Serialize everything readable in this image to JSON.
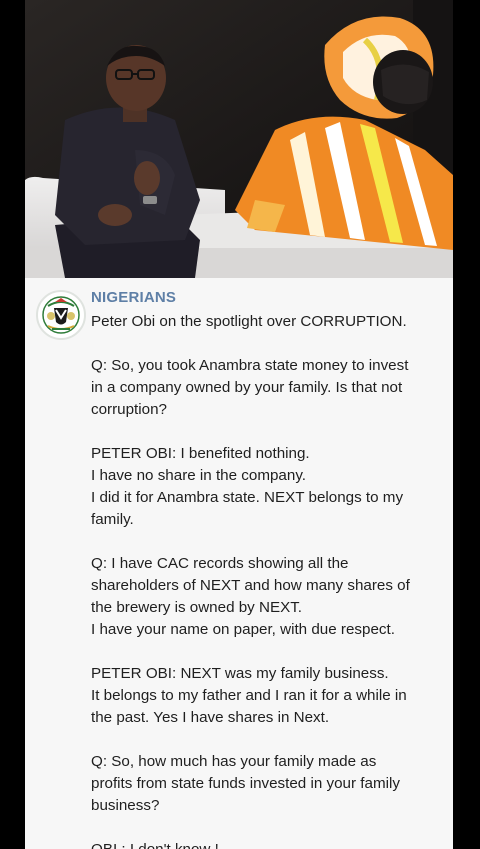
{
  "post": {
    "channel_name": "NIGERIANS",
    "headline": "Peter Obi on the spotlight over CORRUPTION.",
    "paragraphs": [
      "Q: So, you took Anambra state money to invest\nin a company owned by your family. Is that not\ncorruption?",
      "PETER OBI: I benefited nothing.\nI have no share in the company.\nI did it for Anambra state. NEXT belongs to my\nfamily.",
      "Q: I have CAC records showing all the\nshareholders of NEXT and how many shares of\nthe brewery is owned by NEXT.\nI have your name on paper, with due respect.",
      "PETER OBI: NEXT was my family business.\nIt belongs to my father and I ran it for a while in\nthe past. Yes I have shares in Next.",
      "Q: So, how much has your family made as\nprofits from state funds invested in your family\nbusiness?",
      "OBI : I don't know !"
    ]
  },
  "colors": {
    "channel_name": "#5e7fa6",
    "text": "#1f1f1f",
    "post_background": "#f7f7f7",
    "outer_background": "#000000"
  },
  "icons": {
    "avatar": "nigeria-coat-of-arms-icon"
  }
}
